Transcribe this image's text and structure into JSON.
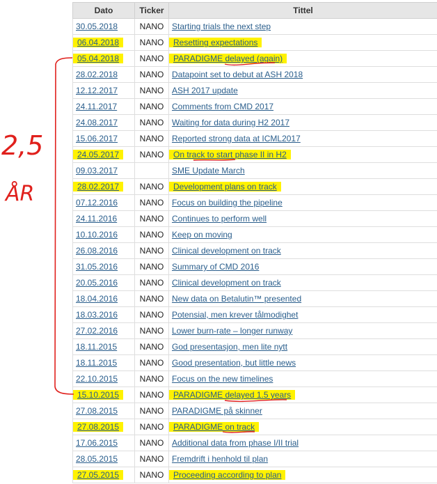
{
  "headers": {
    "date": "Dato",
    "ticker": "Ticker",
    "title": "Tittel"
  },
  "annotation": {
    "years": "2,5",
    "unit": "ÅR",
    "color": "#e0201c"
  },
  "highlight_color": "#fff200",
  "rows": [
    {
      "date": "30.05.2018",
      "ticker": "NANO",
      "title": "Starting trials the next step",
      "hl_date": false,
      "hl_title": false
    },
    {
      "date": "06.04.2018",
      "ticker": "NANO",
      "title": "Resetting expectations",
      "hl_date": true,
      "hl_title": true
    },
    {
      "date": "05.04.2018",
      "ticker": "NANO",
      "title": "PARADIGME delayed (again)",
      "hl_date": true,
      "hl_title": true
    },
    {
      "date": "28.02.2018",
      "ticker": "NANO",
      "title": "Datapoint set to debut at ASH 2018",
      "hl_date": false,
      "hl_title": false
    },
    {
      "date": "12.12.2017",
      "ticker": "NANO",
      "title": "ASH 2017 update",
      "hl_date": false,
      "hl_title": false
    },
    {
      "date": "24.11.2017",
      "ticker": "NANO",
      "title": "Comments from CMD 2017",
      "hl_date": false,
      "hl_title": false
    },
    {
      "date": "24.08.2017",
      "ticker": "NANO",
      "title": "Waiting for data during H2 2017",
      "hl_date": false,
      "hl_title": false
    },
    {
      "date": "15.06.2017",
      "ticker": "NANO",
      "title": "Reported strong data at ICML2017",
      "hl_date": false,
      "hl_title": false
    },
    {
      "date": "24.05.2017",
      "ticker": "NANO",
      "title": "On track to start phase II in H2",
      "hl_date": true,
      "hl_title": true
    },
    {
      "date": "09.03.2017",
      "ticker": "",
      "title": "SME Update March",
      "hl_date": false,
      "hl_title": false
    },
    {
      "date": "28.02.2017",
      "ticker": "NANO",
      "title": "Development plans on track",
      "hl_date": true,
      "hl_title": true
    },
    {
      "date": "07.12.2016",
      "ticker": "NANO",
      "title": "Focus on building the pipeline",
      "hl_date": false,
      "hl_title": false
    },
    {
      "date": "24.11.2016",
      "ticker": "NANO",
      "title": "Continues to perform well",
      "hl_date": false,
      "hl_title": false
    },
    {
      "date": "10.10.2016",
      "ticker": "NANO",
      "title": "Keep on moving",
      "hl_date": false,
      "hl_title": false
    },
    {
      "date": "26.08.2016",
      "ticker": "NANO",
      "title": "Clinical development on track",
      "hl_date": false,
      "hl_title": false
    },
    {
      "date": "31.05.2016",
      "ticker": "NANO",
      "title": "Summary of CMD 2016",
      "hl_date": false,
      "hl_title": false
    },
    {
      "date": "20.05.2016",
      "ticker": "NANO",
      "title": "Clinical development on track",
      "hl_date": false,
      "hl_title": false
    },
    {
      "date": "18.04.2016",
      "ticker": "NANO",
      "title": "New data on Betalutin™ presented",
      "hl_date": false,
      "hl_title": false
    },
    {
      "date": "18.03.2016",
      "ticker": "NANO",
      "title": "Potensial, men krever tålmodighet",
      "hl_date": false,
      "hl_title": false
    },
    {
      "date": "27.02.2016",
      "ticker": "NANO",
      "title": "Lower burn-rate – longer runway",
      "hl_date": false,
      "hl_title": false
    },
    {
      "date": "18.11.2015",
      "ticker": "NANO",
      "title": "God presentasjon, men lite nytt",
      "hl_date": false,
      "hl_title": false
    },
    {
      "date": "18.11.2015",
      "ticker": "NANO",
      "title": "Good presentation, but little news",
      "hl_date": false,
      "hl_title": false
    },
    {
      "date": "22.10.2015",
      "ticker": "NANO",
      "title": "Focus on the new timelines",
      "hl_date": false,
      "hl_title": false
    },
    {
      "date": "15.10.2015",
      "ticker": "NANO",
      "title": "PARADIGME delayed 1.5 years",
      "hl_date": true,
      "hl_title": true
    },
    {
      "date": "27.08.2015",
      "ticker": "NANO",
      "title": "PARADIGME på skinner",
      "hl_date": false,
      "hl_title": false
    },
    {
      "date": "27.08.2015",
      "ticker": "NANO",
      "title": "PARADIGME on track",
      "hl_date": true,
      "hl_title": true
    },
    {
      "date": "17.06.2015",
      "ticker": "NANO",
      "title": "Additional data from phase I/II trial",
      "hl_date": false,
      "hl_title": false
    },
    {
      "date": "28.05.2015",
      "ticker": "NANO",
      "title": "Fremdrift i henhold til plan",
      "hl_date": false,
      "hl_title": false
    },
    {
      "date": "27.05.2015",
      "ticker": "NANO",
      "title": "Proceeding according to plan",
      "hl_date": true,
      "hl_title": true
    }
  ]
}
